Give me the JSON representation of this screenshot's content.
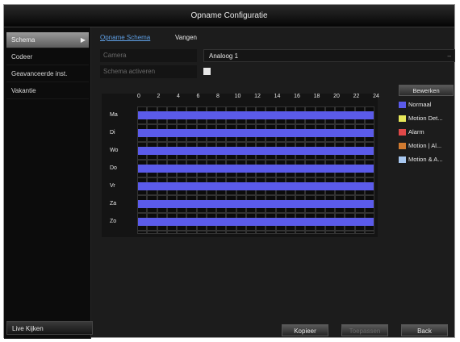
{
  "window": {
    "title": "Opname Configuratie"
  },
  "sidebar": {
    "items": [
      {
        "label": "Schema",
        "active": true
      },
      {
        "label": "Codeer",
        "active": false
      },
      {
        "label": "Geavanceerde inst.",
        "active": false
      },
      {
        "label": "Vakantie",
        "active": false
      }
    ],
    "live_view": "Live Kijken"
  },
  "tabs": [
    {
      "label": "Opname Schema",
      "active": true
    },
    {
      "label": "Vangen",
      "active": false
    }
  ],
  "form": {
    "camera_label": "Camera",
    "camera_value": "Analoog 1",
    "enable_label": "Schema activeren",
    "enable_checked": true
  },
  "schedule": {
    "hours": [
      "0",
      "2",
      "4",
      "6",
      "8",
      "10",
      "12",
      "14",
      "16",
      "18",
      "20",
      "22",
      "24"
    ],
    "days": [
      "Ma",
      "Di",
      "Wo",
      "Do",
      "Vr",
      "Za",
      "Zo"
    ],
    "bar_color": "#5b5bea",
    "recording": "Normaal, 0-24 every day"
  },
  "edit_button": "Bewerken",
  "legend": [
    {
      "label": "Normaal",
      "color": "#5b5bea"
    },
    {
      "label": "Motion Det...",
      "color": "#e8e85a"
    },
    {
      "label": "Alarm",
      "color": "#e04848"
    },
    {
      "label": "Motion | Al...",
      "color": "#d07a30"
    },
    {
      "label": "Motion & A...",
      "color": "#a8c8f0"
    }
  ],
  "buttons": {
    "copy": "Kopieer",
    "apply": "Toepassen",
    "back": "Back"
  }
}
